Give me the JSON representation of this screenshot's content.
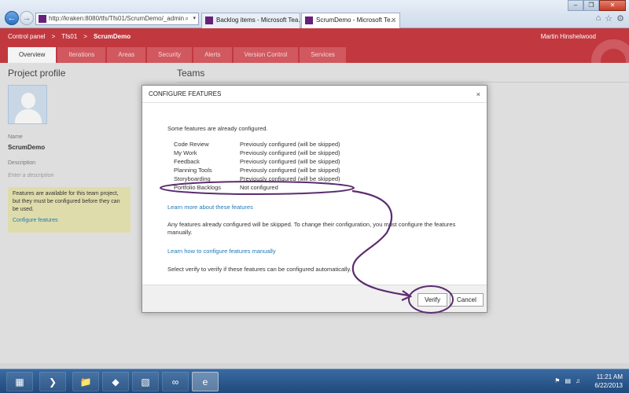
{
  "browser": {
    "address": "http://kraken:8080/tfs/Tfs01/ScrumDemo/_admin",
    "tabs": [
      {
        "label": "Backlog items - Microsoft Tea..."
      },
      {
        "label": "ScrumDemo - Microsoft Te..."
      }
    ]
  },
  "header": {
    "breadcrumb": [
      "Control panel",
      ">",
      "Tfs01",
      ">",
      "ScrumDemo"
    ],
    "user": "Martin Hinshelwood",
    "nav_tabs": [
      "Overview",
      "Iterations",
      "Areas",
      "Security",
      "Alerts",
      "Version Control",
      "Services"
    ],
    "accent": "#c2383f"
  },
  "profile": {
    "title": "Project profile",
    "name_label": "Name",
    "name_value": "ScrumDemo",
    "description_label": "Description",
    "description_placeholder": "Enter a description",
    "notice_text": "Features are available for this team project, but they must be configured before they can be used.",
    "notice_link": "Configure features"
  },
  "teams": {
    "title": "Teams"
  },
  "dialog": {
    "title": "CONFIGURE FEATURES",
    "close": "×",
    "intro": "Some features are already configured.",
    "features": [
      {
        "name": "Code Review",
        "status": "Previously configured (will be skipped)"
      },
      {
        "name": "My Work",
        "status": "Previously configured (will be skipped)"
      },
      {
        "name": "Feedback",
        "status": "Previously configured (will be skipped)"
      },
      {
        "name": "Planning Tools",
        "status": "Previously configured (will be skipped)"
      },
      {
        "name": "Storyboarding",
        "status": "Previously configured (will be skipped)"
      },
      {
        "name": "Portfolio Backlogs",
        "status": "Not configured"
      }
    ],
    "learn_more": "Learn more about these features",
    "skip_text": "Any features already configured will be skipped. To change their configuration, you must configure the features manually.",
    "manual_link": "Learn how to configure features manually",
    "verify_text": "Select verify to verify if these features can be configured automatically.",
    "verify_button": "Verify",
    "cancel_button": "Cancel",
    "annotation_color": "#5b2c6f"
  },
  "taskbar": {
    "time": "11:21 AM",
    "date": "6/22/2013"
  }
}
